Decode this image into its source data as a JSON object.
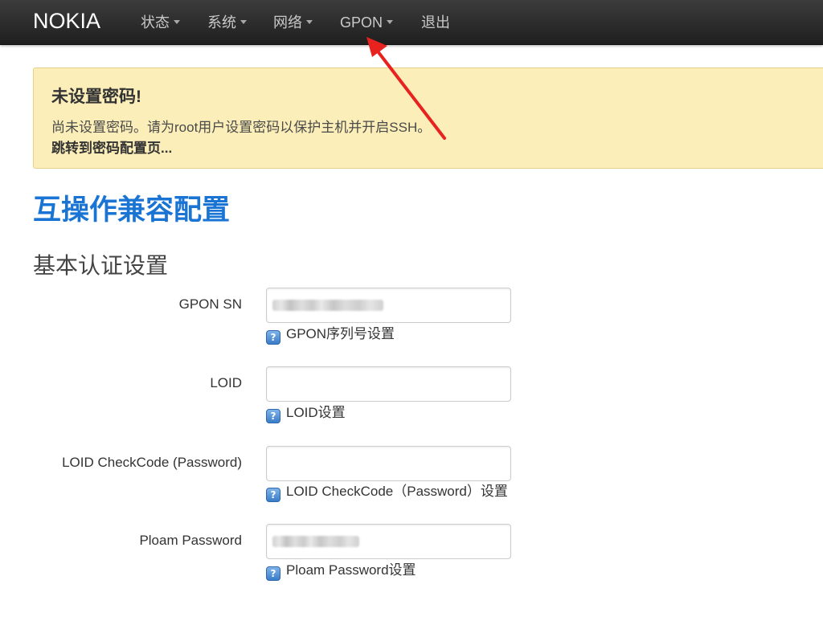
{
  "navbar": {
    "brand": "NOKIA",
    "items": [
      {
        "label": "状态",
        "dropdown": true
      },
      {
        "label": "系统",
        "dropdown": true
      },
      {
        "label": "网络",
        "dropdown": true
      },
      {
        "label": "GPON",
        "dropdown": true
      },
      {
        "label": "退出",
        "dropdown": false
      }
    ]
  },
  "alert": {
    "title": "未设置密码!",
    "message": "尚未设置密码。请为root用户设置密码以保护主机并开启SSH。",
    "link": "跳转到密码配置页..."
  },
  "page": {
    "title": "互操作兼容配置",
    "section_title": "基本认证设置"
  },
  "form": {
    "fields": [
      {
        "label": "GPON SN",
        "value": "",
        "value_obscured": true,
        "help": "GPON序列号设置"
      },
      {
        "label": "LOID",
        "value": "",
        "value_obscured": false,
        "help": "LOID设置"
      },
      {
        "label": "LOID CheckCode (Password)",
        "value": "",
        "value_obscured": false,
        "help": "LOID CheckCode（Password）设置"
      },
      {
        "label": "Ploam Password",
        "value": "",
        "value_obscured": true,
        "help": "Ploam Password设置"
      }
    ]
  },
  "icons": {
    "help": "help-icon",
    "dropdown": "caret-down-icon",
    "annotation": "red-arrow-annotation"
  },
  "colors": {
    "navbar_bg": "#2a2a2a",
    "alert_bg": "#fbeeb8",
    "title_blue": "#1a74d4",
    "annotation_red": "#e8231f"
  }
}
